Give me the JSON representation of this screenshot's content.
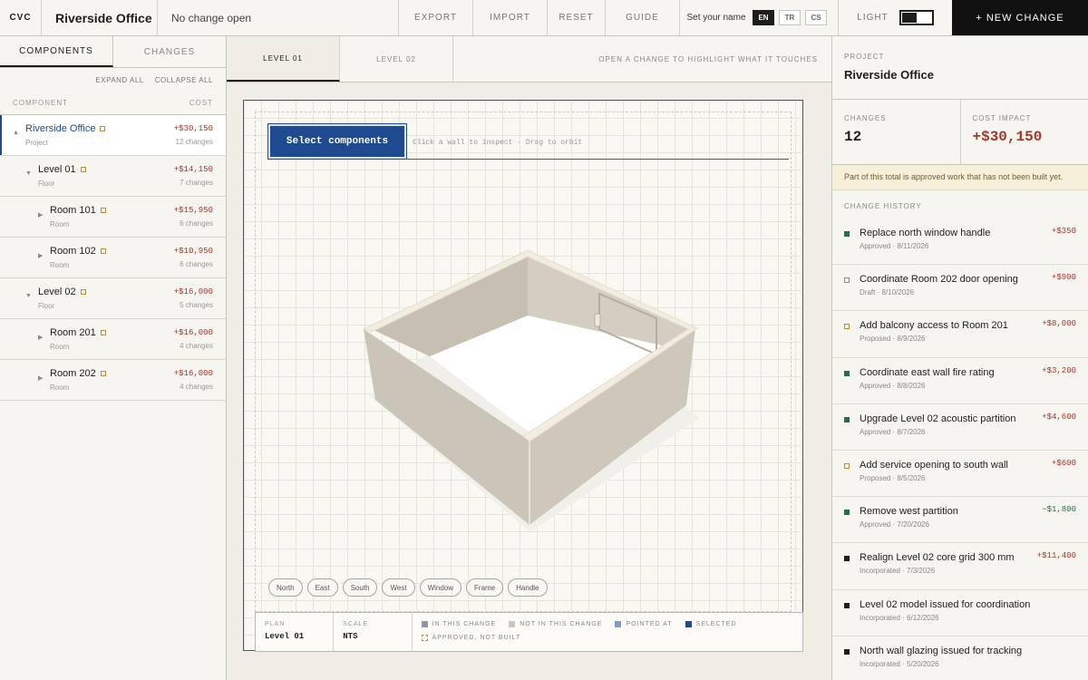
{
  "topbar": {
    "brand": "CVC",
    "project_title": "Riverside Office",
    "change_status": "No change open",
    "export": "EXPORT",
    "import": "IMPORT",
    "reset": "RESET",
    "guide": "GUIDE",
    "name_label": "Set your name",
    "languages": [
      "EN",
      "TR",
      "CS"
    ],
    "active_language": "EN",
    "theme_label": "LIGHT",
    "new_change": "+ NEW CHANGE"
  },
  "left": {
    "tabs": [
      "COMPONENTS",
      "CHANGES"
    ],
    "expand_all": "EXPAND ALL",
    "collapse_all": "COLLAPSE ALL",
    "col_component": "COMPONENT",
    "col_cost": "COST",
    "tree": [
      {
        "name": "Riverside Office",
        "type": "Project",
        "cost": "+$30,150",
        "count": "12 changes",
        "caret": "▲"
      },
      {
        "name": "Level 01",
        "type": "Floor",
        "cost": "+$14,150",
        "count": "7 changes",
        "caret": "▼"
      },
      {
        "name": "Room 101",
        "type": "Room",
        "cost": "+$15,950",
        "count": "6 changes",
        "caret": "▶"
      },
      {
        "name": "Room 102",
        "type": "Room",
        "cost": "+$10,950",
        "count": "6 changes",
        "caret": "▶"
      },
      {
        "name": "Level 02",
        "type": "Floor",
        "cost": "+$16,000",
        "count": "5 changes",
        "caret": "▼"
      },
      {
        "name": "Room 201",
        "type": "Room",
        "cost": "+$16,000",
        "count": "4 changes",
        "caret": "▶"
      },
      {
        "name": "Room 202",
        "type": "Room",
        "cost": "+$16,000",
        "count": "4 changes",
        "caret": "▶"
      }
    ]
  },
  "center": {
    "tabs": [
      "LEVEL 01",
      "LEVEL 02"
    ],
    "top_hint": "OPEN A CHANGE TO HIGHLIGHT WHAT IT TOUCHES",
    "select_button": "Select components",
    "canvas_hint": "Click a wall to inspect · Drag to orbit",
    "chips": [
      "North",
      "East",
      "South",
      "West",
      "Window",
      "Frame",
      "Handle"
    ],
    "legend": {
      "plan_label": "PLAN",
      "plan_value": "Level 01",
      "scale_label": "SCALE",
      "scale_value": "NTS",
      "keys": [
        "IN THIS CHANGE",
        "NOT IN THIS CHANGE",
        "POINTED AT",
        "SELECTED",
        "APPROVED, NOT BUILT"
      ]
    }
  },
  "right": {
    "project_label": "PROJECT",
    "project_name": "Riverside Office",
    "changes_label": "CHANGES",
    "changes_value": "12",
    "impact_label": "COST IMPACT",
    "impact_value": "+$30,150",
    "note": "Part of this total is approved work that has not been built yet.",
    "history_label": "CHANGE HISTORY",
    "history": [
      {
        "title": "Replace north window handle",
        "meta": "Approved · 8/11/2026",
        "amount": "+$350"
      },
      {
        "title": "Coordinate Room 202 door opening",
        "meta": "Draft · 8/10/2026",
        "amount": "+$900"
      },
      {
        "title": "Add balcony access to Room 201",
        "meta": "Proposed · 8/9/2026",
        "amount": "+$8,000"
      },
      {
        "title": "Coordinate east wall fire rating",
        "meta": "Approved · 8/8/2026",
        "amount": "+$3,200"
      },
      {
        "title": "Upgrade Level 02 acoustic partition",
        "meta": "Approved · 8/7/2026",
        "amount": "+$4,600"
      },
      {
        "title": "Add service opening to south wall",
        "meta": "Proposed · 8/5/2026",
        "amount": "+$600"
      },
      {
        "title": "Remove west partition",
        "meta": "Approved · 7/20/2026",
        "amount": "−$1,800"
      },
      {
        "title": "Realign Level 02 core grid 300 mm",
        "meta": "Incorporated · 7/3/2026",
        "amount": "+$11,400"
      },
      {
        "title": "Level 02 model issued for coordination",
        "meta": "Incorporated · 6/12/2026",
        "amount": ""
      },
      {
        "title": "North wall glazing issued for tracking",
        "meta": "Incorporated · 5/20/2026",
        "amount": ""
      }
    ]
  },
  "colors": {
    "accent_blue": "#1f4a8f",
    "cost_red": "#a3362a",
    "approved_green": "#2d6b4d",
    "proposed_gold": "#c08a2f"
  }
}
